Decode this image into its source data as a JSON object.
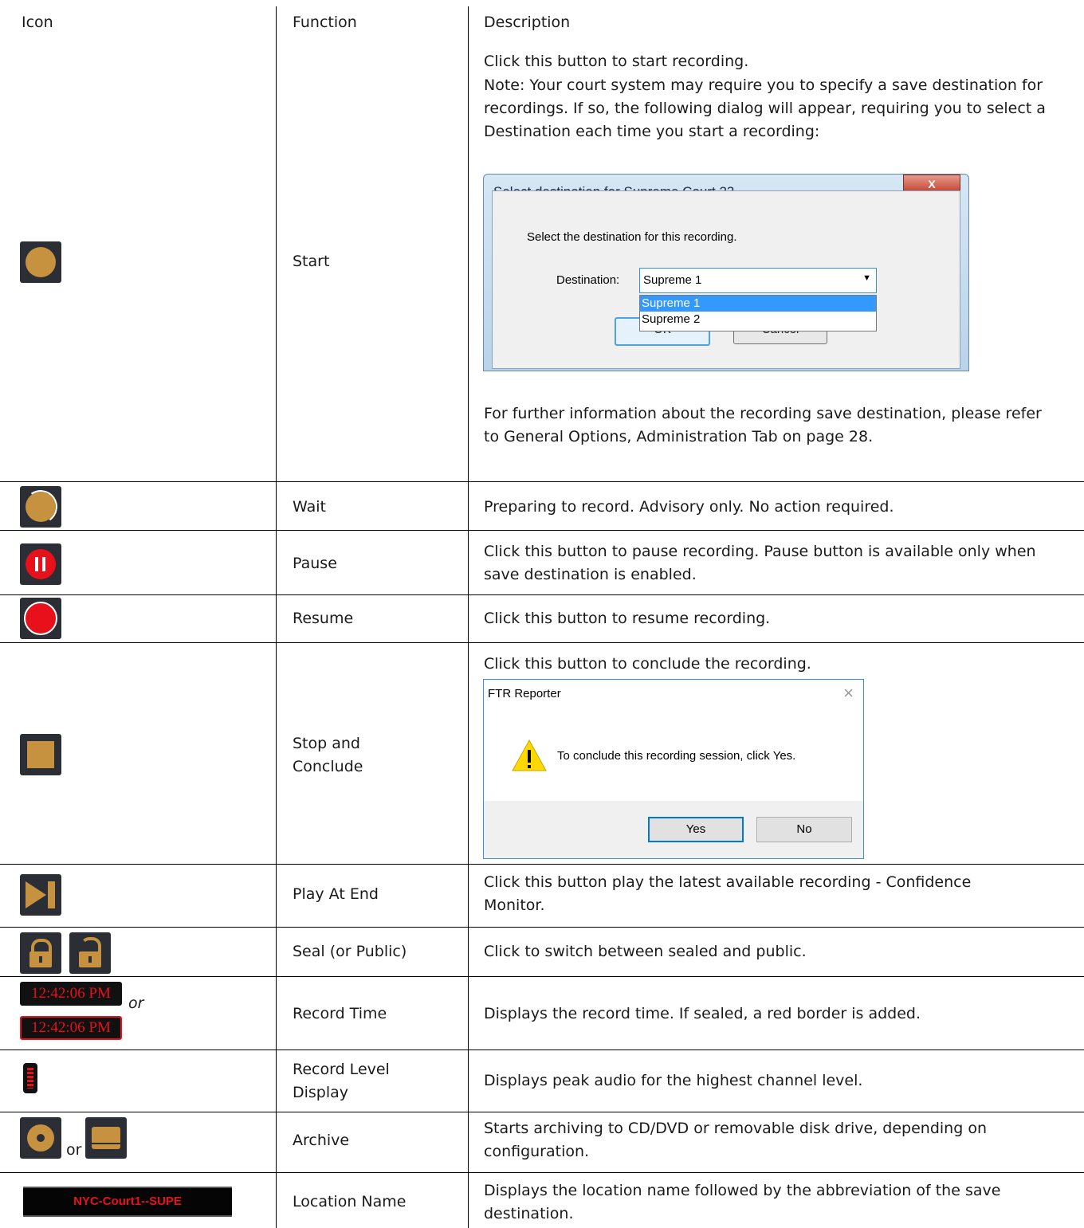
{
  "header": {
    "icon": "Icon",
    "function": "Function",
    "description": "Description"
  },
  "rows": {
    "start": {
      "function": "Start",
      "desc1": "Click this button to start recording.",
      "desc2": "Note: Your court system may require you to specify a save destination for recordings. If so, the following dialog will appear, requiring you to select a Destination each time you start a recording:",
      "desc3": "For further information about the recording save destination, please refer to General Options,  Administration Tab on page 28."
    },
    "wait": {
      "function": "Wait",
      "desc": "Preparing to record. Advisory only. No action required."
    },
    "pause": {
      "function": "Pause",
      "desc": "Click this button to pause recording. Pause button is available only when save destination is enabled."
    },
    "resume": {
      "function": "Resume",
      "desc": "Click this button to resume recording."
    },
    "stop": {
      "function": "Stop and Conclude",
      "desc": "Click this button to conclude the recording."
    },
    "play": {
      "function": "Play At End",
      "desc": "Click this button play the latest available recording - Confidence Monitor."
    },
    "seal": {
      "function": "Seal (or Public)",
      "desc": "Click to switch between sealed and public."
    },
    "rtime": {
      "function": "Record Time",
      "desc": "Displays the record time.  If sealed, a red border is added.",
      "time": "12:42:06 PM",
      "or": "or"
    },
    "rlevel": {
      "function": "Record Level Display",
      "desc": "Displays peak audio for the highest channel level."
    },
    "archive": {
      "function": "Archive",
      "desc": "Starts archiving to CD/DVD or removable disk drive, depending on configuration.",
      "or": "or"
    },
    "location": {
      "function": "Location Name",
      "desc": "Displays the location name followed by the abbreviation of the save destination.",
      "name": "NYC-Court1--SUPE"
    }
  },
  "dialog_destination": {
    "title": "Select destination for Supreme Court 23",
    "prompt": "Select the destination for this recording.",
    "label": "Destination:",
    "selected": "Supreme 1",
    "options": [
      "Supreme 1",
      "Supreme 2"
    ],
    "ok": "OK",
    "cancel": "Cancel",
    "close": "X"
  },
  "dialog_conclude": {
    "title": "FTR Reporter",
    "message": "To conclude this recording session, click Yes.",
    "yes": "Yes",
    "no": "No",
    "close": "×"
  },
  "colors": {
    "icon_bg": "#2b2f35",
    "gold": "#c6923f",
    "red": "#e8111b"
  }
}
